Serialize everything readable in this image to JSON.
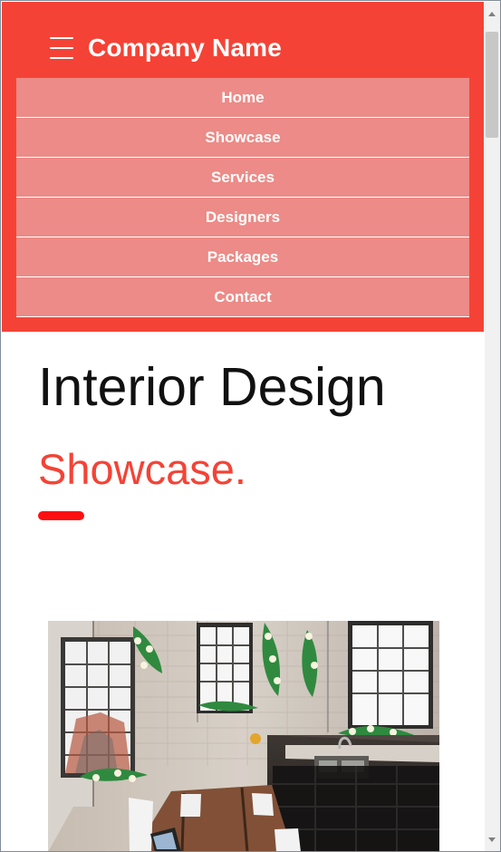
{
  "header": {
    "brand_name": "Company Name",
    "menu_icon": "hamburger-menu-icon"
  },
  "nav": {
    "items": [
      {
        "label": "Home"
      },
      {
        "label": "Showcase"
      },
      {
        "label": "Services"
      },
      {
        "label": "Designers"
      },
      {
        "label": "Packages"
      },
      {
        "label": "Contact"
      }
    ]
  },
  "hero": {
    "title": "Interior Design",
    "subtitle": "Showcase."
  },
  "colors": {
    "primary": "#f44336",
    "nav_item_bg": "#ec8b87",
    "accent": "#ff1010"
  }
}
